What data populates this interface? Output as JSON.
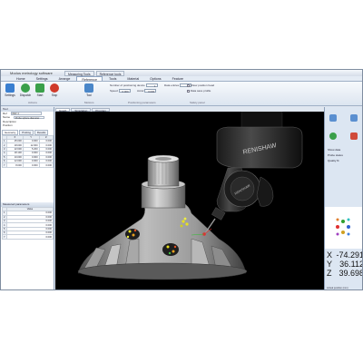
{
  "window": {
    "title": "Modus metrology software"
  },
  "title_tabs": [
    "Measuring Tools",
    "Reference tools"
  ],
  "menu": {
    "tabs": [
      "Home",
      "Settings",
      "Arrange",
      "Reference",
      "Tools",
      "Material",
      "Options",
      "Feature"
    ],
    "active_index": 3
  },
  "ribbon": {
    "buttons": [
      {
        "label": "Settings",
        "icon": "gear-icon",
        "color": "#3a7fd0"
      },
      {
        "label": "Dispatch",
        "icon": "arrows-icon",
        "color": "#3aa04a"
      },
      {
        "label": "Start",
        "icon": "start-icon",
        "color": "#3aa04a"
      },
      {
        "label": "Stop",
        "icon": "stop-icon",
        "color": "#d03a2a"
      },
      {
        "label": "Tool",
        "icon": "probe-icon",
        "color": "#4a86c8"
      }
    ],
    "fields": [
      {
        "label": "Number of positioning device",
        "value": "1"
      },
      {
        "label": "Speed",
        "value": "0.000"
      },
      {
        "label": "Accel",
        "value": "0.000"
      },
      {
        "label": "Data entries",
        "value": "0"
      }
    ],
    "checks": [
      "Show position head",
      "Data save profile"
    ],
    "groups": [
      "Actions",
      "Motions",
      "Positioning parameters",
      "Safety panel"
    ]
  },
  "doc_tabs": [
    "Graph",
    "Simulation",
    "Program"
  ],
  "left_panel": {
    "header": "Tool",
    "fields": [
      {
        "label": "Ref",
        "value": "REF 4"
      },
      {
        "label": "Name",
        "value": "Probe sphere diameter"
      },
      {
        "label": "Description",
        "value": ""
      },
      {
        "label": "Position",
        "value": ""
      }
    ],
    "tabs": [
      "Geometry",
      "Probing",
      "Results"
    ],
    "columns": [
      "",
      "X",
      "Y",
      "Z"
    ],
    "rows": [
      [
        "1",
        "25.000",
        "0.000",
        "0.000"
      ],
      [
        "2",
        "18.000",
        "12.000",
        "0.000"
      ],
      [
        "3",
        "22.600",
        "5.200",
        "0.000"
      ],
      [
        "4",
        "18.100",
        "0.000",
        "0.000"
      ],
      [
        "5",
        "10.000",
        "0.000",
        "0.000"
      ],
      [
        "6",
        "12.000",
        "0.000",
        "0.000"
      ],
      [
        "7",
        "8.000",
        "0.000",
        "0.000"
      ]
    ],
    "section2_header": "Measured parameters",
    "section2_columns": [
      "",
      "Value"
    ],
    "section2_rows": [
      [
        "1",
        "0.000"
      ],
      [
        "2",
        "0.000"
      ],
      [
        "3",
        "0.000"
      ],
      [
        "4",
        "0.000"
      ],
      [
        "5",
        "0.000"
      ],
      [
        "6",
        "0.000"
      ],
      [
        "7",
        "0.000"
      ]
    ]
  },
  "viewport": {
    "probe_brand": "RENISHAW",
    "probe_head_brand": "RENISHAW"
  },
  "right_panel": {
    "items": [
      "Show data",
      "Probe status",
      "Quality fit"
    ],
    "coords": [
      {
        "axis": "X",
        "value": "-74.291"
      },
      {
        "axis": "Y",
        "value": "36.112"
      },
      {
        "axis": "Z",
        "value": "39.698"
      }
    ],
    "footer": "Actual position (mm)"
  },
  "colors": {
    "accent": "#3a7fd0",
    "background": "#000000"
  }
}
